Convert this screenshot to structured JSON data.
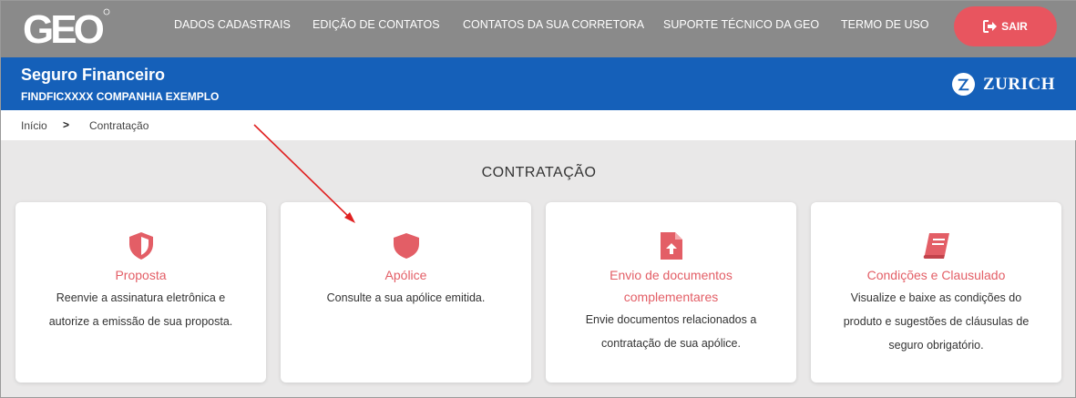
{
  "header": {
    "logo_text": "GEO",
    "nav": [
      "DADOS CADASTRAIS",
      "EDIÇÃO DE CONTATOS",
      "CONTATOS DA SUA CORRETORA",
      "SUPORTE TÉCNICO DA GEO",
      "TERMO DE USO"
    ],
    "logout_label": "SAIR"
  },
  "band": {
    "title": "Seguro Financeiro",
    "code": "FINDFICXXXX",
    "company": "COMPANHIA EXEMPLO",
    "brand": "ZURICH"
  },
  "breadcrumb": {
    "home": "Início",
    "current": "Contratação"
  },
  "section_title": "CONTRATAÇÃO",
  "cards": [
    {
      "title": "Proposta",
      "desc1": "Reenvie a assinatura eletrônica e",
      "desc2": "autorize a emissão de sua proposta.",
      "desc3": "",
      "icon": "shield-half-icon"
    },
    {
      "title": "Apólice",
      "desc1": "Consulte a sua apólice emitida.",
      "desc2": "",
      "desc3": "",
      "icon": "shield-icon"
    },
    {
      "title1": "Envio de documentos",
      "title2": "complementares",
      "desc1": "Envie documentos relacionados a",
      "desc2": "contratação de sua apólice.",
      "icon": "file-upload-icon"
    },
    {
      "title": "Condições e Clausulado",
      "desc1": "Visualize e baixe as condições do",
      "desc2": "produto e sugestões de cláusulas de",
      "desc3": "seguro obrigatório.",
      "icon": "book-icon"
    }
  ],
  "colors": {
    "accent": "#e35e66",
    "band": "#1560b9",
    "topbar": "#8a8a8a",
    "logout": "#e8555f",
    "annotation": "#e02020"
  }
}
